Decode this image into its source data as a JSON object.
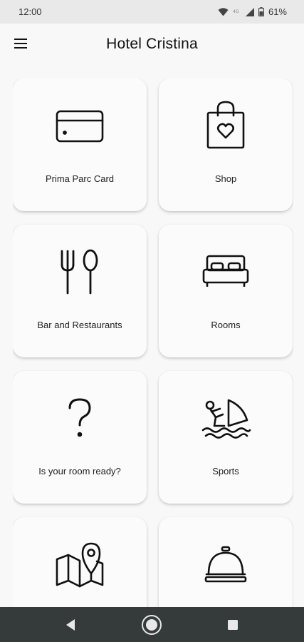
{
  "status_bar": {
    "time": "12:00",
    "battery": "61%",
    "icons": [
      "wifi-icon",
      "network-4g-icon",
      "signal-icon",
      "battery-icon"
    ]
  },
  "app_bar": {
    "title": "Hotel Cristina",
    "menu_icon": "hamburger-menu-icon"
  },
  "tiles": [
    {
      "label": "Prima Parc Card",
      "icon": "credit-card-icon"
    },
    {
      "label": "Shop",
      "icon": "shopping-bag-heart-icon"
    },
    {
      "label": "Bar and Restaurants",
      "icon": "fork-spoon-icon"
    },
    {
      "label": "Rooms",
      "icon": "bed-icon"
    },
    {
      "label": "Is your room ready?",
      "icon": "question-mark-icon"
    },
    {
      "label": "Sports",
      "icon": "windsurf-icon"
    },
    {
      "label": "",
      "icon": "map-pin-icon"
    },
    {
      "label": "",
      "icon": "service-bell-icon"
    }
  ],
  "nav_bar": {
    "buttons": [
      "back-icon",
      "home-icon",
      "recents-icon"
    ]
  },
  "colors": {
    "background": "#f8f8f8",
    "card": "#fbfbfb",
    "status_bar": "#e9e9e9",
    "nav_bar": "#353b3b",
    "icon_stroke": "#111111"
  }
}
